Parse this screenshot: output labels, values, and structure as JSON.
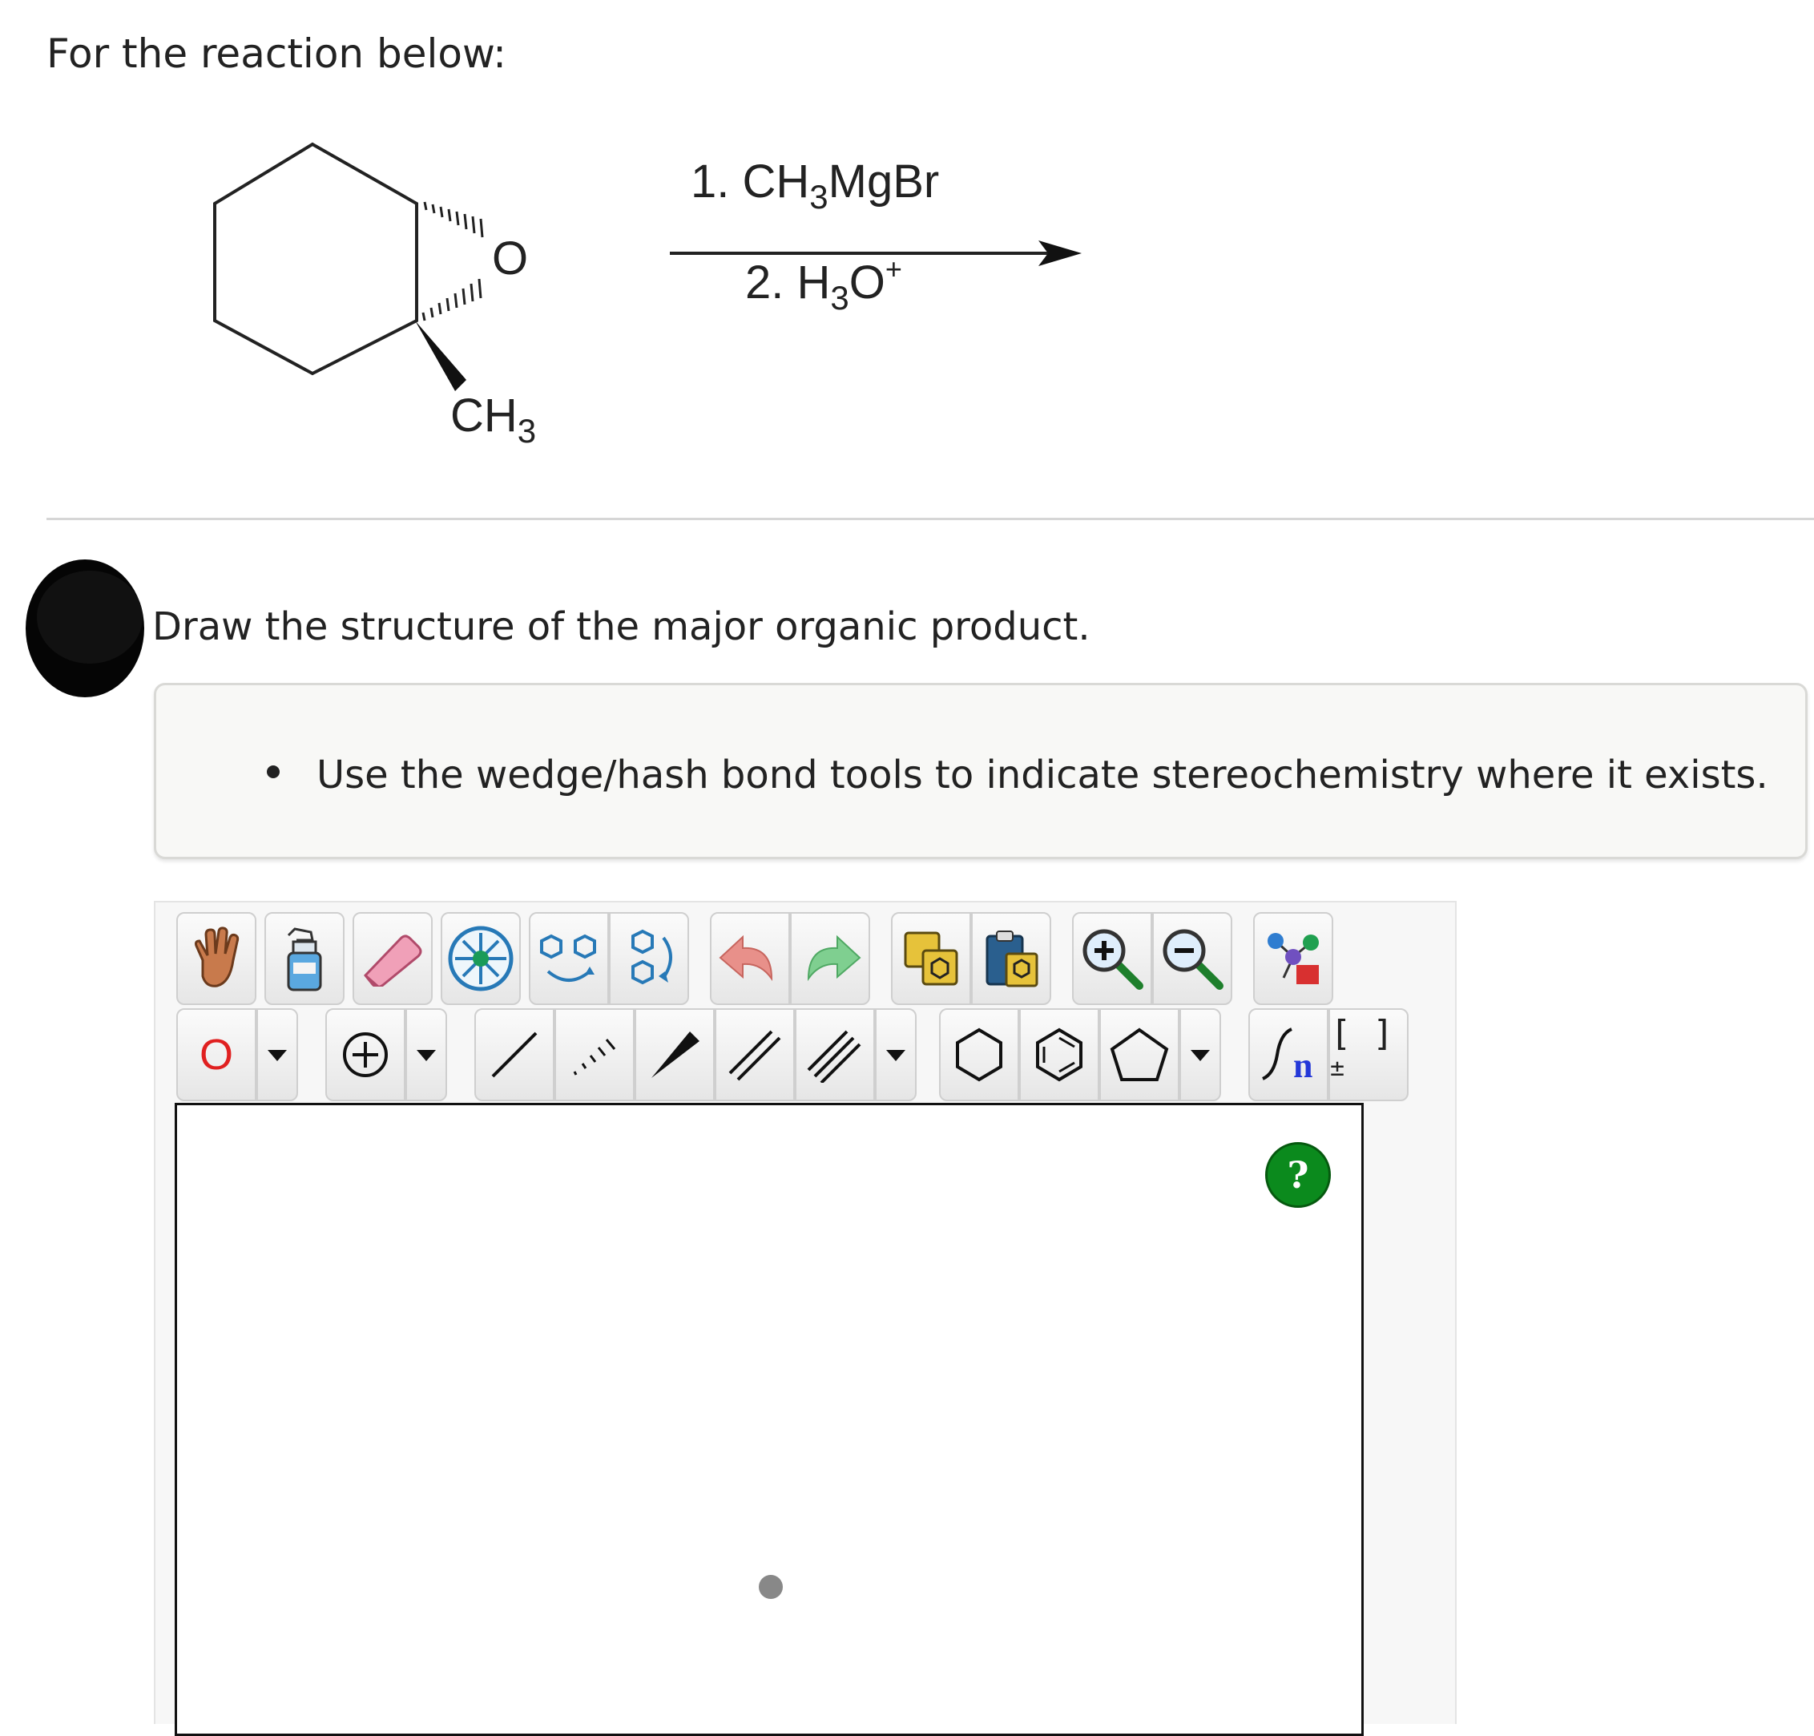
{
  "prompt": "For the reaction below:",
  "reaction": {
    "substituent": "CH",
    "substituent_sub": "3",
    "oxygen": "O",
    "step1_prefix": "1. CH",
    "step1_sub": "3",
    "step1_suffix": "MgBr",
    "step2_prefix": "2. H",
    "step2_sub": "3",
    "step2_suffix": "O",
    "step2_sup": "+"
  },
  "question": "Draw the structure of the major organic product.",
  "hint": "Use the wedge/hash bond tools to indicate stereochemistry where it exists.",
  "toolbar": {
    "atom_label": "O",
    "sgroup_n": "n",
    "bracket_label": "[ ]",
    "bracket_sup": "±",
    "atom_color": "#e02020",
    "help_color": "#0b8a1d"
  },
  "canvas": {
    "help_label": "?"
  }
}
